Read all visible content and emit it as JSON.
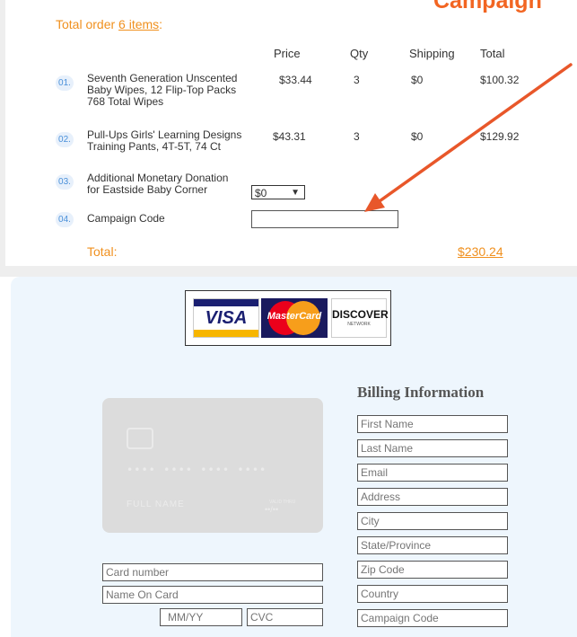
{
  "callout": {
    "text": "Campaign"
  },
  "order": {
    "title_prefix": "Total order",
    "title_link": "6 items",
    "title_suffix": ":",
    "columns": {
      "price": "Price",
      "qty": "Qty",
      "shipping": "Shipping",
      "total": "Total"
    },
    "items": [
      {
        "num": "01.",
        "line1": "Seventh Generation Unscented",
        "line2": "Baby Wipes, 12 Flip-Top Packs",
        "line3": "768 Total Wipes",
        "price": "$33.44",
        "qty": "3",
        "shipping": "$0",
        "total": "$100.32"
      },
      {
        "num": "02.",
        "line1": "Pull-Ups Girls' Learning Designs",
        "line2": "Training Pants, 4T-5T, 74 Ct",
        "price": "$43.31",
        "qty": "3",
        "shipping": "$0",
        "total": "$129.92"
      },
      {
        "num": "03.",
        "line1": "Additional Monetary Donation",
        "line2": "for Eastside Baby Corner",
        "donation_value": "$0"
      },
      {
        "num": "04.",
        "line1": "Campaign Code"
      }
    ],
    "total_label": "Total:",
    "total_value": "$230.24"
  },
  "cards": {
    "visa": "VISA",
    "mastercard": "MasterCard",
    "discover": "DISCOVER",
    "discover_sub": "NETWORK"
  },
  "card_preview": {
    "number": "•••• •••• •••• ••••",
    "name": "FULL NAME",
    "expiry_label": "VALID THRU",
    "expiry": "••/••"
  },
  "payment_fields": {
    "card_number": "Card number",
    "name_on_card": "Name On Card",
    "expiry": "MM/YY",
    "cvc": "CVC"
  },
  "billing": {
    "title": "Billing Information",
    "fields": [
      "First Name",
      "Last Name",
      "Email",
      "Address",
      "City",
      "State/Province",
      "Zip Code",
      "Country",
      "Campaign Code"
    ]
  },
  "colors": {
    "accent_orange": "#f0901e",
    "arrow": "#e8572a",
    "billing_bg": "#eef6fd"
  }
}
